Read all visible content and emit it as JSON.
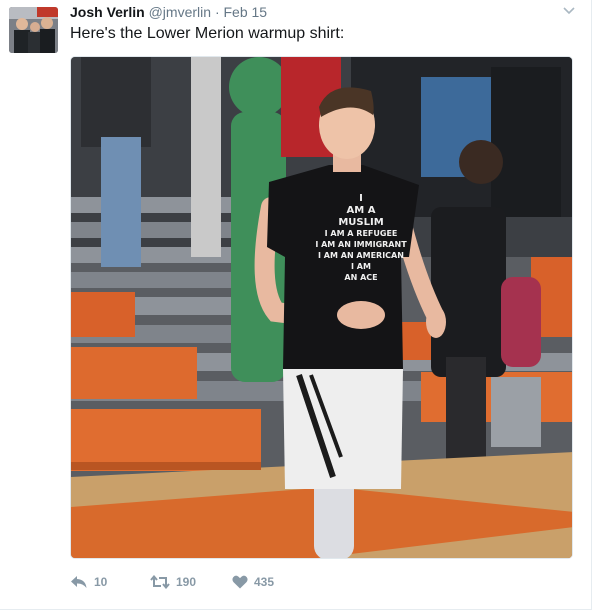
{
  "tweet": {
    "author_name": "Josh Verlin",
    "author_handle": "@jmverlin",
    "separator": "·",
    "date": "Feb 15",
    "text": "Here's the Lower Merion warmup shirt:"
  },
  "media": {
    "shirt_lines": [
      "I",
      "AM A",
      "MUSLIM",
      "I AM A REFUGEE",
      "I AM AN IMMIGRANT",
      "I AM AN AMERICAN",
      "I AM",
      "AN ACE"
    ]
  },
  "actions": {
    "reply_count": "10",
    "retweet_count": "190",
    "like_count": "435"
  },
  "colors": {
    "action_gray": "#8899a6",
    "handle_gray": "#657786",
    "text_dark": "#14171a"
  },
  "icons": {
    "caret": "chevron-down-icon",
    "reply": "reply-icon",
    "retweet": "retweet-icon",
    "like": "heart-icon"
  }
}
